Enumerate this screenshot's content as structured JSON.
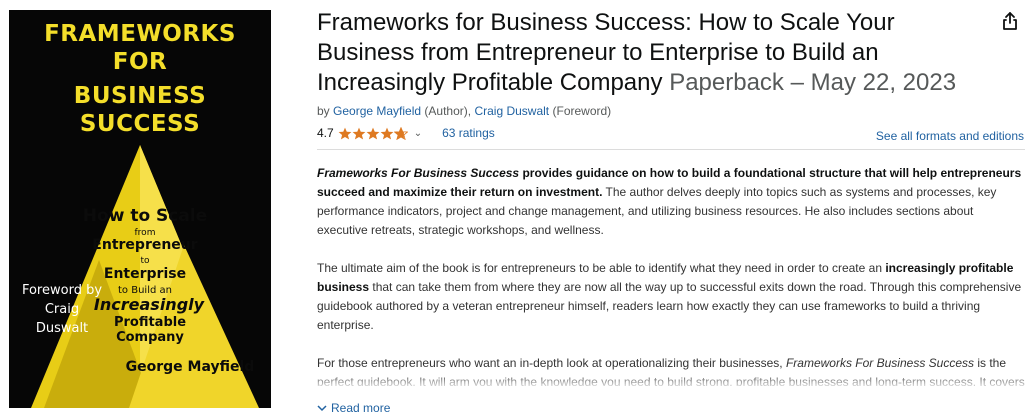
{
  "cover": {
    "title_lines": [
      "FRAMEWORKS",
      "FOR",
      "BUSINESS",
      "SUCCESS"
    ],
    "subtitle": {
      "how": "How to Scale",
      "from": "from",
      "entrepreneur": "Entrepreneur",
      "to": "to",
      "enterprise": "Enterprise",
      "to_build": "to Build an",
      "increasingly": "Increasingly",
      "profitable": "Profitable",
      "company": "Company"
    },
    "foreword_lines": [
      "Foreword by",
      "Craig",
      "Duswalt"
    ],
    "author": "George Mayfield",
    "colors": {
      "background": "#060606",
      "accent": "#f4de2a"
    }
  },
  "product": {
    "title": "Frameworks for Business Success: How to Scale Your Business from Entrepreneur to Enterprise to Build an Increasingly Profitable Company",
    "format": "Paperback – May 22, 2023",
    "byline": {
      "by": "by",
      "author1": "George Mayfield",
      "role1": "(Author),",
      "author2": "Craig Duswalt",
      "role2": "(Foreword)"
    },
    "rating": 4.7,
    "rating_text": "4.7",
    "ratings_count": "63 ratings",
    "formats_link": "See all formats and editions",
    "share_icon": "share-icon"
  },
  "description": {
    "p1_bold": "Frameworks For Business Success",
    "p1_bold2": "provides guidance on how to build a foundational structure that will help entrepreneurs succeed and maximize their return on investment.",
    "p1_rest": " The author delves deeply into topics such as systems and processes, key performance indicators, project and change management, and utilizing business resources. He also includes sections about executive retreats, strategic workshops, and wellness.",
    "p2_a": "The ultimate aim of the book is for entrepreneurs to be able to identify what they need in order to create an ",
    "p2_bold": "increasingly profitable business",
    "p2_b": " that can take them from where they are now all the way up to successful exits down the road. Through this comprehensive guidebook authored by a veteran entrepreneur himself, readers learn how exactly they can use frameworks to build a thriving enterprise.",
    "p3_a": "For those entrepreneurs who want an in-depth look at operationalizing their businesses, ",
    "p3_italic": "Frameworks For Business Success",
    "p3_b": " is the perfect guidebook. It will arm you with the knowledge you need to build strong, profitable businesses and long-term success. It covers everything from getting advice from experienced professionals (and knowing who to trust); creating joint",
    "read_more": "Read more"
  }
}
